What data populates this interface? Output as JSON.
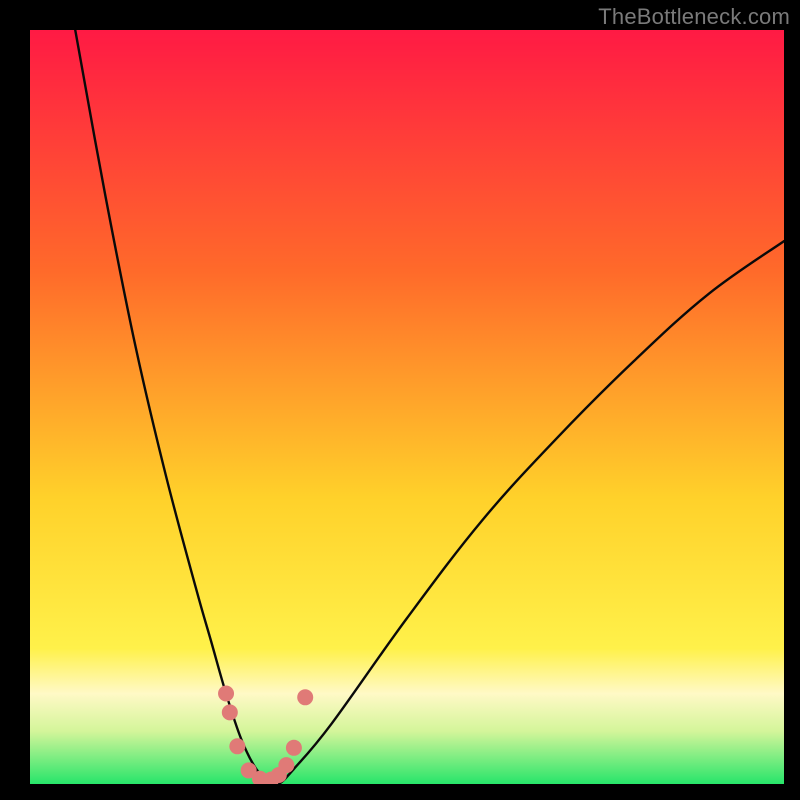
{
  "watermark": "TheBottleneck.com",
  "colors": {
    "frame": "#000000",
    "watermark": "#7a7a7a",
    "curve": "#0a0a0a",
    "markers": "#e07a77",
    "gradient": {
      "top": "#ff1a44",
      "upper_mid": "#ff6a2a",
      "mid": "#ffd12a",
      "lower_band_center": "#fff9c6",
      "bottom": "#27e56a"
    }
  },
  "chart_data": {
    "type": "line",
    "title": "",
    "xlabel": "",
    "ylabel": "",
    "xlim": [
      0,
      100
    ],
    "ylim": [
      0,
      100
    ],
    "grid": false,
    "legend": false,
    "description": "Asymmetric V-curve (bottleneck curve). Minimum near x≈30, y≈0. Left branch rises steeply to y≈100 at x≈6; right branch rises gently to y≈72 at x≈100.",
    "series": [
      {
        "name": "bottleneck-curve",
        "x": [
          6,
          10,
          14,
          18,
          22,
          24,
          26,
          28,
          30,
          32,
          33,
          35,
          40,
          50,
          60,
          70,
          80,
          90,
          100
        ],
        "y": [
          100,
          78,
          58,
          41,
          26,
          19,
          12,
          6,
          2,
          0,
          0,
          2,
          8,
          22,
          35,
          46,
          56,
          65,
          72
        ]
      }
    ],
    "markers": [
      {
        "x": 26.0,
        "y": 12.0
      },
      {
        "x": 26.5,
        "y": 9.5
      },
      {
        "x": 27.5,
        "y": 5.0
      },
      {
        "x": 29.0,
        "y": 1.8
      },
      {
        "x": 30.5,
        "y": 0.7
      },
      {
        "x": 32.0,
        "y": 0.6
      },
      {
        "x": 33.0,
        "y": 1.2
      },
      {
        "x": 34.0,
        "y": 2.5
      },
      {
        "x": 35.0,
        "y": 4.8
      },
      {
        "x": 36.5,
        "y": 11.5
      }
    ],
    "marker_radius_px": 8
  }
}
